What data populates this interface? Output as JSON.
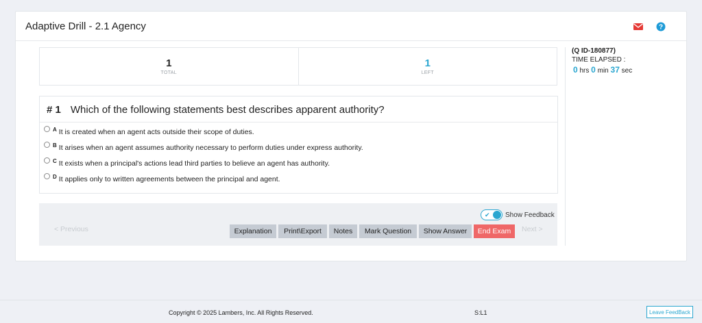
{
  "header": {
    "title": "Adaptive Drill - 2.1 Agency",
    "icons": {
      "mail": "envelope-icon",
      "help": "question-circle-icon"
    },
    "colors": {
      "mail": "#e53935",
      "help": "#1e9bd7"
    }
  },
  "stats": {
    "total_value": "1",
    "total_label": "TOTAL",
    "left_value": "1",
    "left_label": "LEFT"
  },
  "side": {
    "qid": "(Q ID-180877)",
    "elapsed_label": "TIME ELAPSED :",
    "hours": "0",
    "hours_unit": "hrs",
    "minutes": "0",
    "minutes_unit": "min",
    "seconds": "37",
    "seconds_unit": "sec"
  },
  "question": {
    "number": "# 1",
    "text": "Which of the following statements best describes apparent authority?",
    "options": [
      {
        "letter": "A",
        "text": "It is created when an agent acts outside their scope of duties."
      },
      {
        "letter": "B",
        "text": "It arises when an agent assumes authority necessary to perform duties under express authority."
      },
      {
        "letter": "C",
        "text": "It exists when a principal's actions lead third parties to believe an agent has authority."
      },
      {
        "letter": "D",
        "text": "It applies only to written agreements between the principal and agent."
      }
    ]
  },
  "toolbar": {
    "show_feedback_label": "Show Feedback",
    "show_feedback_on": true,
    "previous_label": "< Previous",
    "next_label": "Next >",
    "explanation_label": "Explanation",
    "print_export_label": "Print\\Export",
    "notes_label": "Notes",
    "mark_question_label": "Mark Question",
    "show_answer_label": "Show Answer",
    "end_exam_label": "End Exam",
    "accent_color": "#2aa6d0",
    "danger_color": "#ef6767"
  },
  "footer": {
    "copyright": "Copyright © 2025 Lambers, Inc. All Rights Reserved.",
    "sl": "S:L1",
    "leave_feedback_label": "Leave FeedBack"
  }
}
